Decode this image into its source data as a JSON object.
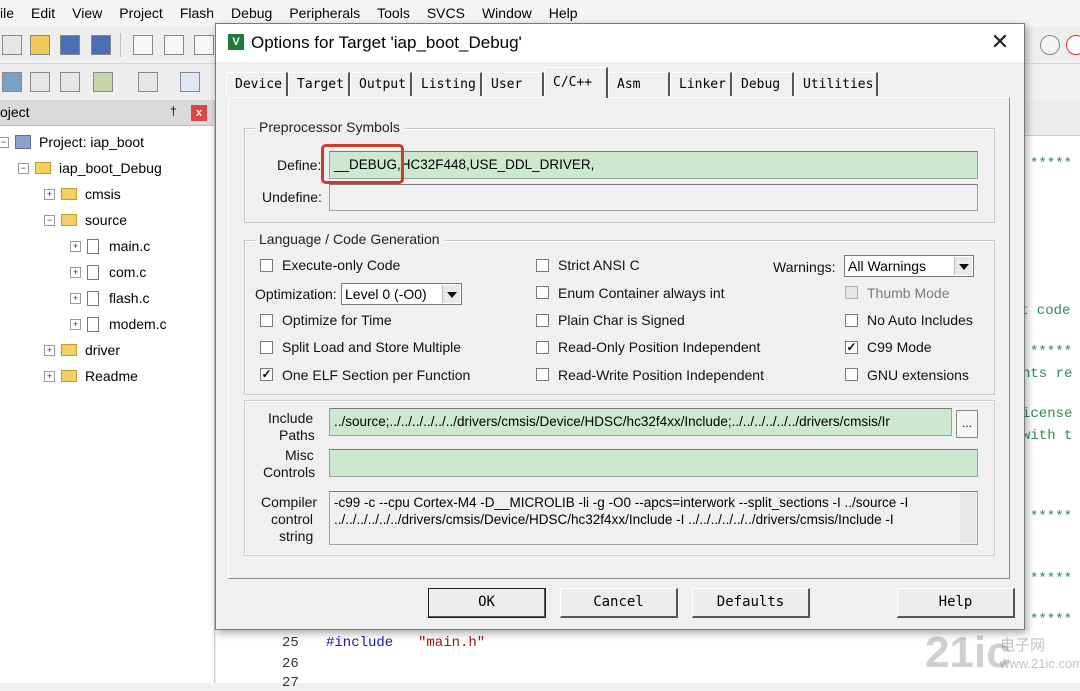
{
  "ide": {
    "menu": [
      "ile",
      "Edit",
      "View",
      "Project",
      "Flash",
      "Debug",
      "Peripherals",
      "Tools",
      "SVCS",
      "Window",
      "Help"
    ],
    "panel_title": "oject",
    "panel_pin": "†",
    "panel_close": "x",
    "tree": {
      "project": "Project: iap_boot",
      "target": "iap_boot_Debug",
      "groups": [
        "cmsis",
        "source",
        "driver",
        "Readme"
      ],
      "files": [
        "main.c",
        "com.c",
        "flash.c",
        "modem.c"
      ],
      "exp_plus": "+",
      "exp_minus": "−"
    },
    "code": {
      "stars": "*****",
      "fragment1": "t code",
      "fragment2": "nts re",
      "fragment3": "icense",
      "fragment4": "with t",
      "line25": "25",
      "line26": "26",
      "line27": "27",
      "include_kw": "#include",
      "include_file": "\"main.h\""
    },
    "watermark": "21ic",
    "watermark_sub": "电子网",
    "watermark_url": "www.21ic.com"
  },
  "dialog": {
    "icon": "V",
    "title": "Options for Target 'iap_boot_Debug'",
    "close": "✕",
    "tabs": [
      "Device",
      "Target",
      "Output",
      "Listing",
      "User",
      "C/C++",
      "Asm",
      "Linker",
      "Debug",
      "Utilities"
    ],
    "active_tab": "C/C++",
    "preprocessor": {
      "group_label": "Preprocessor Symbols",
      "define_label": "Define:",
      "define_value": "__DEBUG,HC32F448,USE_DDL_DRIVER,",
      "undefine_label": "Undefine:",
      "undefine_value": ""
    },
    "language": {
      "group_label": "Language / Code Generation",
      "execute_only": "Execute-only Code",
      "optimization_label": "Optimization:",
      "optimization_value": "Level 0 (-O0)",
      "optimize_time": "Optimize for Time",
      "split_load": "Split Load and Store Multiple",
      "one_elf": "One ELF Section per Function",
      "strict_ansi": "Strict ANSI C",
      "enum_container": "Enum Container always int",
      "plain_char": "Plain Char is Signed",
      "ro_pi": "Read-Only Position Independent",
      "rw_pi": "Read-Write Position Independent",
      "warnings_label": "Warnings:",
      "warnings_value": "All Warnings",
      "thumb_mode": "Thumb Mode",
      "no_auto_includes": "No Auto Includes",
      "c99_mode": "C99 Mode",
      "gnu_ext": "GNU extensions",
      "checkmark": "✓"
    },
    "paths": {
      "include_label_1": "Include",
      "include_label_2": "Paths",
      "include_value": "../source;../../../../../../drivers/cmsis/Device/HDSC/hc32f4xx/Include;../../../../../../drivers/cmsis/Ir",
      "browse": "...",
      "misc_label_1": "Misc",
      "misc_label_2": "Controls",
      "misc_value": "",
      "compiler_label_1": "Compiler",
      "compiler_label_2": "control",
      "compiler_label_3": "string",
      "compiler_line1": "-c99 -c --cpu Cortex-M4 -D__MICROLIB -li -g -O0 --apcs=interwork --split_sections -I ../source -I",
      "compiler_line2": "../../../../../../drivers/cmsis/Device/HDSC/hc32f4xx/Include -I ../../../../../../drivers/cmsis/Include -I"
    },
    "buttons": {
      "ok": "OK",
      "cancel": "Cancel",
      "defaults": "Defaults",
      "help": "Help"
    }
  }
}
